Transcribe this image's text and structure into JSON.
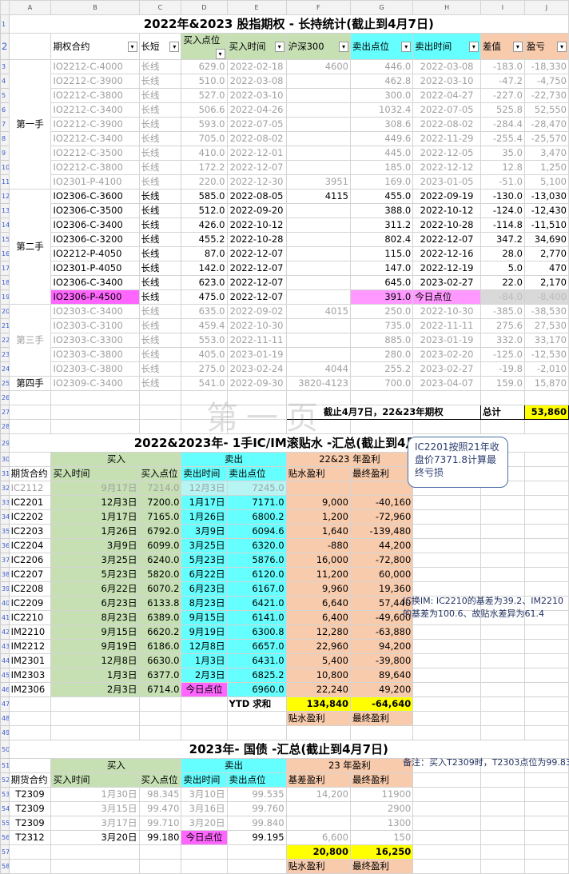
{
  "sheet": {
    "col_headers": [
      "A",
      "B",
      "C",
      "D",
      "E",
      "F",
      "G",
      "H",
      "I",
      "J"
    ]
  },
  "options": {
    "title": "2022年&2023 股指期权 - 长持统计(截止到4月7日)",
    "headers": [
      "期权合约",
      "长短",
      "买入点位",
      "买入时间",
      "沪深300",
      "卖出点位",
      "卖出时间",
      "差值",
      "盈亏"
    ],
    "groups": [
      {
        "label": "第一手",
        "rows": [
          [
            "IO2212-C-4000",
            "长线",
            "629.0",
            "2022-02-18",
            "4600",
            "446.0",
            "2022-03-08",
            "-183.0",
            "-18,330"
          ],
          [
            "IO2212-C-3900",
            "长线",
            "510.0",
            "2022-03-08",
            "",
            "462.8",
            "2022-03-10",
            "-47.2",
            "-4,750"
          ],
          [
            "IO2212-C-3800",
            "长线",
            "527.0",
            "2022-03-10",
            "",
            "300.0",
            "2022-04-27",
            "-227.0",
            "-22,730"
          ],
          [
            "IO2212-C-3400",
            "长线",
            "506.6",
            "2022-04-26",
            "",
            "1032.4",
            "2022-07-05",
            "525.8",
            "52,550"
          ],
          [
            "IO2212-C-3900",
            "长线",
            "593.0",
            "2022-07-05",
            "",
            "308.6",
            "2022-08-02",
            "-284.4",
            "-28,470"
          ],
          [
            "IO2212-C-3400",
            "长线",
            "705.0",
            "2022-08-02",
            "",
            "449.6",
            "2022-11-29",
            "-255.4",
            "-25,570"
          ],
          [
            "IO2212-C-3500",
            "长线",
            "410.0",
            "2022-12-01",
            "",
            "445.0",
            "2022-12-05",
            "35.0",
            "3,470"
          ],
          [
            "IO2212-C-3800",
            "长线",
            "172.2",
            "2022-12-07",
            "",
            "185.0",
            "2022-12-12",
            "12.8",
            "1,250"
          ],
          [
            "IO2301-P-4100",
            "长线",
            "220.0",
            "2022-12-30",
            "3951",
            "169.0",
            "2023-01-05",
            "-51.0",
            "5,100"
          ]
        ]
      },
      {
        "label": "第二手",
        "rows": [
          [
            "IO2306-C-3600",
            "长线",
            "585.0",
            "2022-08-05",
            "4115",
            "455.0",
            "2022-09-19",
            "-130.0",
            "-13,030"
          ],
          [
            "IO2306-C-3500",
            "长线",
            "512.0",
            "2022-09-20",
            "",
            "388.0",
            "2022-10-12",
            "-124.0",
            "-12,430"
          ],
          [
            "IO2306-C-3400",
            "长线",
            "426.0",
            "2022-10-12",
            "",
            "311.2",
            "2022-10-28",
            "-114.8",
            "-11,510"
          ],
          [
            "IO2306-C-3200",
            "长线",
            "455.2",
            "2022-10-28",
            "",
            "802.4",
            "2022-12-07",
            "347.2",
            "34,690"
          ],
          [
            "IO2212-P-4050",
            "长线",
            "87.0",
            "2022-12-07",
            "",
            "115.0",
            "2022-12-16",
            "28.0",
            "2,770"
          ],
          [
            "IO2301-P-4050",
            "长线",
            "142.0",
            "2022-12-07",
            "",
            "147.0",
            "2022-12-19",
            "5.0",
            "470"
          ],
          [
            "IO2306-C-3400",
            "长线",
            "623.0",
            "2022-12-07",
            "",
            "645.0",
            "2023-02-27",
            "22.0",
            "2,170"
          ],
          [
            "IO2306-P-4500",
            "长线",
            "475.0",
            "2022-12-07",
            "",
            "391.0",
            "今日点位",
            "-84.0",
            "-8,400"
          ]
        ]
      },
      {
        "label": "第三手",
        "rows": [
          [
            "IO2303-C-3400",
            "长线",
            "635.0",
            "2022-09-02",
            "4015",
            "250.0",
            "2022-10-30",
            "-385.0",
            "-38,530"
          ],
          [
            "IO2303-C-3100",
            "长线",
            "459.4",
            "2022-10-30",
            "",
            "735.0",
            "2022-11-11",
            "275.6",
            "27,530"
          ],
          [
            "IO2303-C-3300",
            "长线",
            "553.0",
            "2022-11-11",
            "",
            "885.0",
            "2023-01-19",
            "332.0",
            "33,170"
          ],
          [
            "IO2303-C-3800",
            "长线",
            "405.0",
            "2023-01-19",
            "",
            "280.0",
            "2023-02-20",
            "-125.0",
            "-12,530"
          ],
          [
            "IO2303-C-3800",
            "长线",
            "275.0",
            "2023-02-24",
            "4044",
            "255.2",
            "2023-02-27",
            "-19.8",
            "-2,010"
          ]
        ]
      },
      {
        "label": "第四手",
        "rows": [
          [
            "IO2309-C-3400",
            "长线",
            "541.0",
            "2022-09-30",
            "3820-4123",
            "700.0",
            "2023-04-07",
            "159.0",
            "15,870"
          ]
        ]
      }
    ],
    "summary_label": "截止4月7日，22&23年期权",
    "total_label": "总计",
    "total_value": "53,860"
  },
  "futures": {
    "title": "2022&2023年- 1手IC/IM滚贴水 -汇总(截止到4月7日)",
    "watermark": "第一页",
    "group_buy": "买入",
    "group_sell": "卖出",
    "group_profit": "22&23 年盈利",
    "headers": [
      "期货合约",
      "买入时间",
      "买入点位",
      "卖出时间",
      "卖出点位",
      "贴水盈利",
      "最终盈利"
    ],
    "rows": [
      [
        "IC2112",
        "9月17日",
        "7214.0",
        "12月3日",
        "7245.0",
        "",
        ""
      ],
      [
        "IC2201",
        "12月3日",
        "7200.0",
        "1月17日",
        "7171.0",
        "9,000",
        "-40,160"
      ],
      [
        "IC2202",
        "1月17日",
        "7165.0",
        "1月26日",
        "6800.2",
        "1,200",
        "-72,960"
      ],
      [
        "IC2203",
        "1月26日",
        "6792.0",
        "3月9日",
        "6094.6",
        "1,640",
        "-139,480"
      ],
      [
        "IC2204",
        "3月9日",
        "6099.0",
        "3月25日",
        "6320.0",
        "-880",
        "44,200"
      ],
      [
        "IC2206",
        "3月25日",
        "6240.0",
        "5月23日",
        "5876.0",
        "16,000",
        "-72,800"
      ],
      [
        "IC2207",
        "5月23日",
        "5820.0",
        "6月22日",
        "6120.0",
        "11,200",
        "60,000"
      ],
      [
        "IC2208",
        "6月22日",
        "6070.2",
        "6月23日",
        "6167.0",
        "9,960",
        "19,360"
      ],
      [
        "IC2209",
        "6月23日",
        "6133.8",
        "8月23日",
        "6421.0",
        "6,640",
        "57,440"
      ],
      [
        "IC2210",
        "8月23日",
        "6389.0",
        "9月15日",
        "6141.0",
        "6,400",
        "-49,600"
      ],
      [
        "IM2210",
        "9月15日",
        "6620.2",
        "9月19日",
        "6300.8",
        "12,280",
        "-63,880"
      ],
      [
        "IM2212",
        "9月19日",
        "6186.0",
        "12月8日",
        "6657.0",
        "22,960",
        "94,200"
      ],
      [
        "IM2301",
        "12月8日",
        "6630.0",
        "1月3日",
        "6431.0",
        "5,400",
        "-39,800"
      ],
      [
        "IM2303",
        "1月3日",
        "6377.0",
        "2月3日",
        "6825.2",
        "10,800",
        "89,640"
      ],
      [
        "IM2306",
        "2月3日",
        "6714.0",
        "今日点位",
        "6960.0",
        "22,240",
        "49,200"
      ]
    ],
    "ytd_label": "YTD 求和",
    "ytd_discount": "134,840",
    "ytd_final": "-64,640",
    "foot_discount": "贴水盈利",
    "foot_final": "最终盈利",
    "callout": "IC2201按照21年收盘价7371.8计算最终亏损",
    "note_im": "IC换IM: IC2210的基差为39.2、IM2210的基差为100.6、故贴水差异为61.4"
  },
  "bonds": {
    "title": "2023年- 国债 -汇总(截止到4月7日)",
    "group_buy": "买入",
    "group_sell": "卖出",
    "group_profit": "23 年盈利",
    "headers": [
      "期货合约",
      "买入时间",
      "买入点位",
      "卖出时间",
      "卖出点位",
      "基差盈利",
      "最终盈利"
    ],
    "rows": [
      [
        "T2309",
        "1月30日",
        "98.345",
        "3月10日",
        "99.535",
        "14,200",
        "11900"
      ],
      [
        "T2309",
        "3月15日",
        "99.470",
        "3月16日",
        "99.760",
        "",
        "2900"
      ],
      [
        "T2309",
        "3月17日",
        "99.710",
        "3月20日",
        "99.840",
        "",
        "1300"
      ],
      [
        "T2312",
        "3月20日",
        "99.180",
        "今日点位",
        "99.195",
        "6,600",
        "150"
      ]
    ],
    "sum_basis": "20,800",
    "sum_final": "16,250",
    "foot_basis": "贴水盈利",
    "foot_final": "最终盈利",
    "note": "备注：买入T2309时，T2303点位为99.835"
  }
}
